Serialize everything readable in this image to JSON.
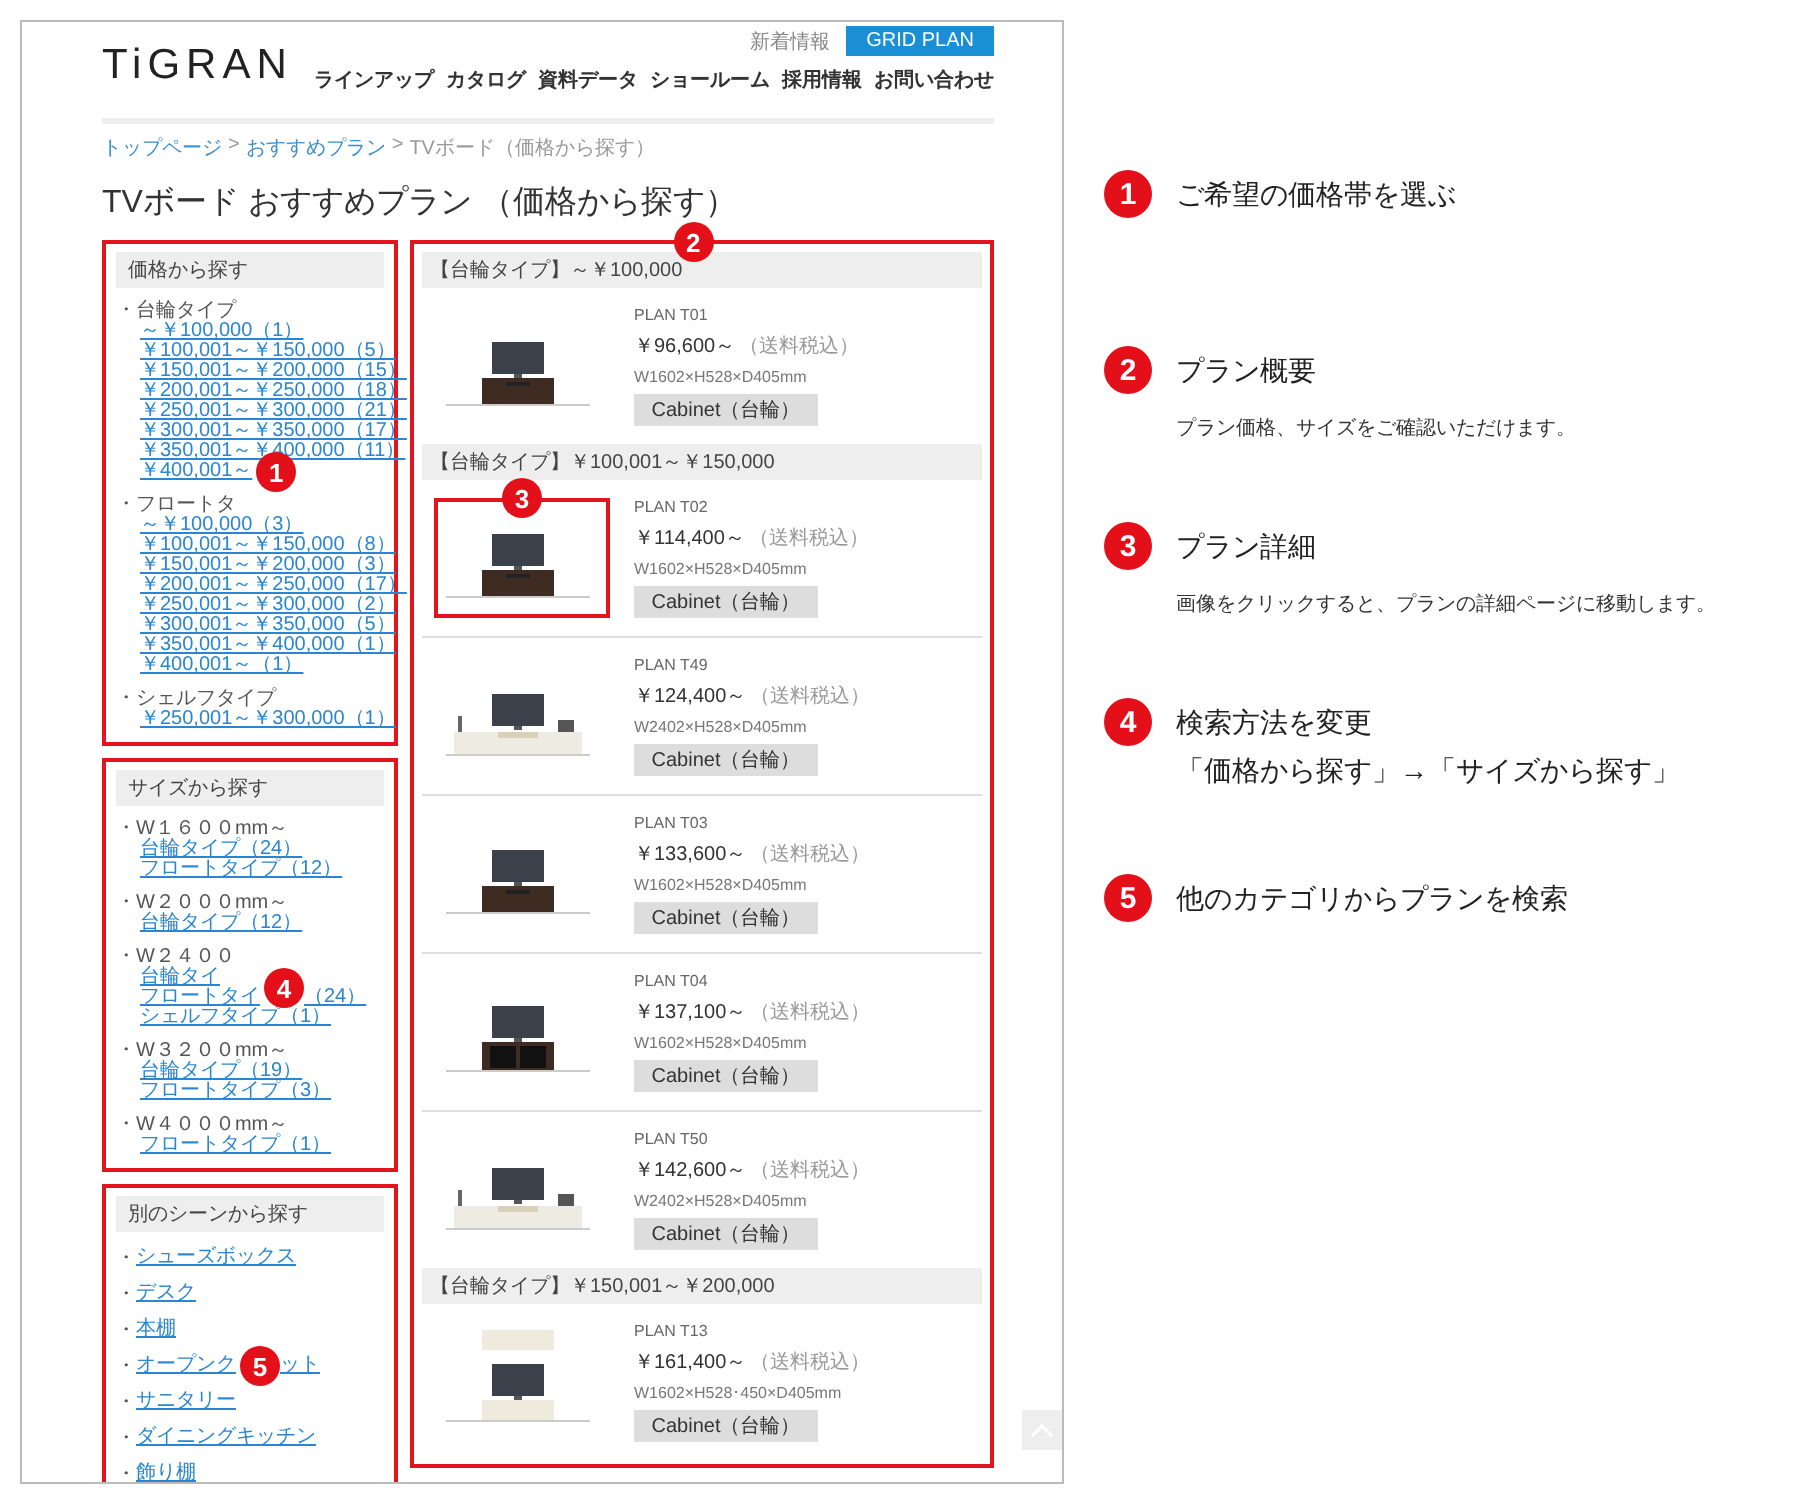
{
  "header": {
    "logo": "TiGRAN",
    "top_link": "新着情報",
    "top_button": "GRID PLAN",
    "nav": [
      "ラインアップ",
      "カタログ",
      "資料データ",
      "ショールーム",
      "採用情報",
      "お問い合わせ"
    ]
  },
  "breadcrumb": [
    {
      "label": "トップページ",
      "kind": "link"
    },
    {
      "label": ">",
      "kind": "separator"
    },
    {
      "label": "おすすめプラン",
      "kind": "link"
    },
    {
      "label": ">",
      "kind": "separator"
    },
    {
      "label": "TVボード（価格から探す）",
      "kind": "current"
    }
  ],
  "title": "TVボード おすすめプラン （価格から探す）",
  "sidebar": [
    {
      "heading": "価格から探す",
      "kind": "groups",
      "groups": [
        {
          "label": "・台輪タイプ",
          "links": [
            {
              "text": "～￥100,000（1）"
            },
            {
              "text": "￥100,001～￥150,000（5）"
            },
            {
              "text": "￥150,001～￥200,000（15）"
            },
            {
              "text": "￥200,001～￥250,000（18）"
            },
            {
              "text": "￥250,001～￥300,000（21）"
            },
            {
              "text": "￥300,001～￥350,000（17）"
            },
            {
              "text": "￥350,001～￥400,000（11）"
            },
            {
              "text": "￥400,001～",
              "marker": "1"
            }
          ]
        },
        {
          "label": "・フロートタ",
          "links": [
            {
              "text": "～￥100,000（3）"
            },
            {
              "text": "￥100,001～￥150,000（8）"
            },
            {
              "text": "￥150,001～￥200,000（3）"
            },
            {
              "text": "￥200,001～￥250,000（17）"
            },
            {
              "text": "￥250,001～￥300,000（2）"
            },
            {
              "text": "￥300,001～￥350,000（5）"
            },
            {
              "text": "￥350,001～￥400,000（1）"
            },
            {
              "text": "￥400,001～（1）"
            }
          ]
        },
        {
          "label": "・シェルフタイプ",
          "links": [
            {
              "text": "￥250,001～￥300,000（1）"
            }
          ]
        }
      ]
    },
    {
      "heading": "サイズから探す",
      "kind": "groups",
      "groups": [
        {
          "label": "・W１６００mm～",
          "links": [
            {
              "text": "台輪タイプ（24）"
            },
            {
              "text": "フロートタイプ（12）"
            }
          ]
        },
        {
          "label": "・W２０００mm～",
          "links": [
            {
              "text": "台輪タイプ（12）"
            }
          ]
        },
        {
          "label": "・W２４００",
          "links": [
            {
              "text": "台輪タイ"
            },
            {
              "text": "フロートタイ",
              "marker": "4",
              "after": "（24）"
            },
            {
              "text": "シェルフタイプ（1）"
            }
          ]
        },
        {
          "label": "・W３２００mm～",
          "links": [
            {
              "text": "台輪タイプ（19）"
            },
            {
              "text": "フロートタイプ（3）"
            }
          ]
        },
        {
          "label": "・W４０００mm～",
          "links": [
            {
              "text": "フロートタイプ（1）"
            }
          ]
        }
      ]
    },
    {
      "heading": "別のシーンから探す",
      "kind": "list",
      "links": [
        {
          "bullet": "・",
          "text": "シューズボックス"
        },
        {
          "bullet": "・",
          "text": "デスク"
        },
        {
          "bullet": "・",
          "text": "本棚"
        },
        {
          "bullet": "・",
          "text": "オープンク",
          "marker": "5",
          "after": "ット"
        },
        {
          "bullet": "・",
          "text": "サニタリー"
        },
        {
          "bullet": "・",
          "text": "ダイニングキッチン"
        },
        {
          "bullet": "・",
          "text": "飾り棚"
        }
      ]
    }
  ],
  "main": {
    "marker": "2",
    "groups": [
      {
        "heading": "【台輪タイプ】～￥100,000",
        "plans": [
          {
            "name": "PLAN T01",
            "price": "￥96,600～",
            "tax": "（送料税込）",
            "size": "W1602×H528×D405mm",
            "tag": "Cabinet（台輪）"
          }
        ]
      },
      {
        "heading": "【台輪タイプ】￥100,001～￥150,000",
        "plans": [
          {
            "name": "PLAN T02",
            "price": "￥114,400～",
            "tax": "（送料税込）",
            "size": "W1602×H528×D405mm",
            "tag": "Cabinet（台輪）",
            "marker": "3"
          },
          {
            "name": "PLAN T49",
            "price": "￥124,400～",
            "tax": "（送料税込）",
            "size": "W2402×H528×D405mm",
            "tag": "Cabinet（台輪）"
          },
          {
            "name": "PLAN T03",
            "price": "￥133,600～",
            "tax": "（送料税込）",
            "size": "W1602×H528×D405mm",
            "tag": "Cabinet（台輪）"
          },
          {
            "name": "PLAN T04",
            "price": "￥137,100～",
            "tax": "（送料税込）",
            "size": "W1602×H528×D405mm",
            "tag": "Cabinet（台輪）"
          },
          {
            "name": "PLAN T50",
            "price": "￥142,600～",
            "tax": "（送料税込）",
            "size": "W2402×H528×D405mm",
            "tag": "Cabinet（台輪）"
          }
        ]
      },
      {
        "heading": "【台輪タイプ】￥150,001～￥200,000",
        "plans": [
          {
            "name": "PLAN T13",
            "price": "￥161,400～",
            "tax": "（送料税込）",
            "size": "W1602×H528･450×D405mm",
            "tag": "Cabinet（台輪）"
          }
        ]
      }
    ]
  },
  "annotations": [
    {
      "marker": "1",
      "title": "ご希望の価格帯を選ぶ"
    },
    {
      "marker": "2",
      "title": "プラン概要",
      "note": "プラン価格、サイズをご確認いただけます。"
    },
    {
      "marker": "3",
      "title": "プラン詳細",
      "note": "画像をクリックすると、プランの詳細ページに移動します。"
    },
    {
      "marker": "4",
      "title": "検索方法を変更",
      "subtitle": "「価格から探す」→「サイズから探す」"
    },
    {
      "marker": "5",
      "title": "他のカテゴリからプランを検索"
    }
  ]
}
